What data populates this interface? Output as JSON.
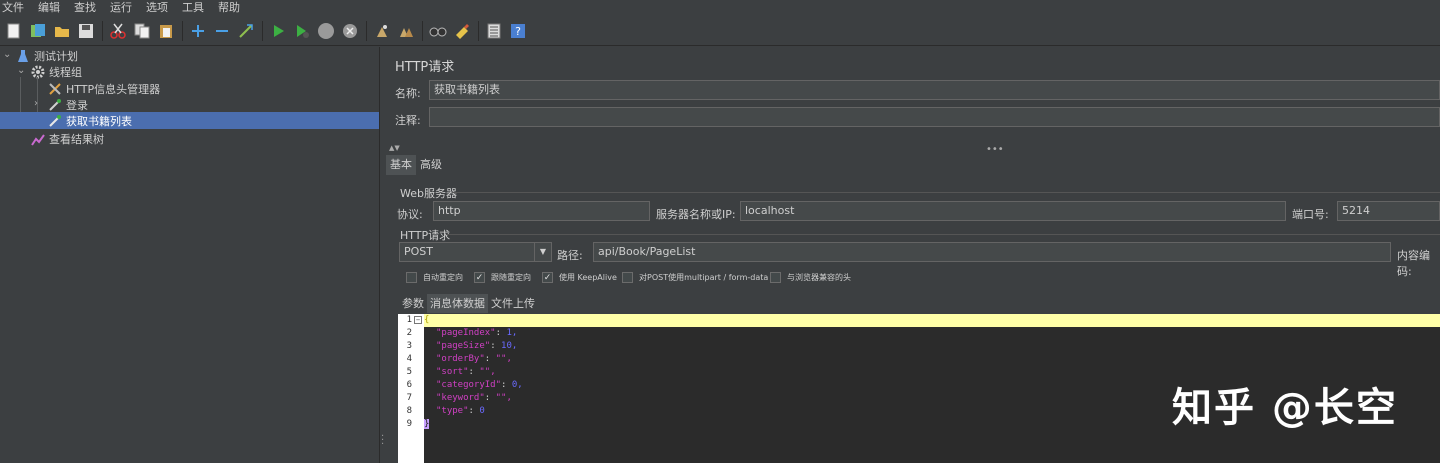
{
  "menu": [
    "文件",
    "编辑",
    "查找",
    "运行",
    "选项",
    "工具",
    "帮助"
  ],
  "toolbar_icons": [
    "new-icon",
    "templates-icon",
    "open-icon",
    "save-icon",
    "cut-icon",
    "copy-icon",
    "paste-icon",
    "expand-icon",
    "collapse-icon",
    "toggle-icon",
    "start-icon",
    "start-no-pause-icon",
    "stop-icon",
    "shutdown-icon",
    "clear-icon",
    "clear-all-icon",
    "search-icon",
    "reset-search-icon",
    "function-helper-icon",
    "help-icon"
  ],
  "tree": {
    "test_plan": "测试计划",
    "thread_group": "线程组",
    "header_manager": "HTTP信息头管理器",
    "login": "登录",
    "get_book_list": "获取书籍列表",
    "results_tree": "查看结果树"
  },
  "panel": {
    "title": "HTTP请求",
    "name_label": "名称:",
    "name_value": "获取书籍列表",
    "comment_label": "注释:",
    "comment_value": "",
    "tabs": [
      "基本",
      "高级"
    ],
    "web_server_title": "Web服务器",
    "protocol_label": "协议:",
    "protocol_value": "http",
    "server_label": "服务器名称或IP:",
    "server_value": "localhost",
    "port_label": "端口号:",
    "port_value": "5214",
    "http_request_title": "HTTP请求",
    "method_value": "POST",
    "path_label": "路径:",
    "path_value": "api/Book/PageList",
    "encoding_label": "内容编码:",
    "checkboxes": [
      {
        "label": "自动重定向",
        "checked": false
      },
      {
        "label": "跟随重定向",
        "checked": true
      },
      {
        "label": "使用 KeepAlive",
        "checked": true
      },
      {
        "label": "对POST使用multipart / form-data",
        "checked": false
      },
      {
        "label": "与浏览器兼容的头",
        "checked": false
      }
    ],
    "subtabs": [
      "参数",
      "消息体数据",
      "文件上传"
    ]
  },
  "editor": {
    "line_numbers": [
      "1",
      "2",
      "3",
      "4",
      "5",
      "6",
      "7",
      "8",
      "9"
    ],
    "lines": [
      {
        "key": "",
        "value": "{"
      },
      {
        "key": "\"pageIndex\"",
        "value": "1,"
      },
      {
        "key": "\"pageSize\"",
        "value": "10,"
      },
      {
        "key": "\"orderBy\"",
        "value": "\"\","
      },
      {
        "key": "\"sort\"",
        "value": "\"\","
      },
      {
        "key": "\"categoryId\"",
        "value": "0,"
      },
      {
        "key": "\"keyword\"",
        "value": "\"\","
      },
      {
        "key": "\"type\"",
        "value": "0"
      },
      {
        "key": "",
        "value": "}"
      }
    ]
  },
  "watermark": "知乎 @长空",
  "colors": {
    "background": "#3c3f41",
    "selection": "#4b6eaf",
    "editor_highlight": "#ffffa8",
    "json_key": "#d040c4"
  }
}
